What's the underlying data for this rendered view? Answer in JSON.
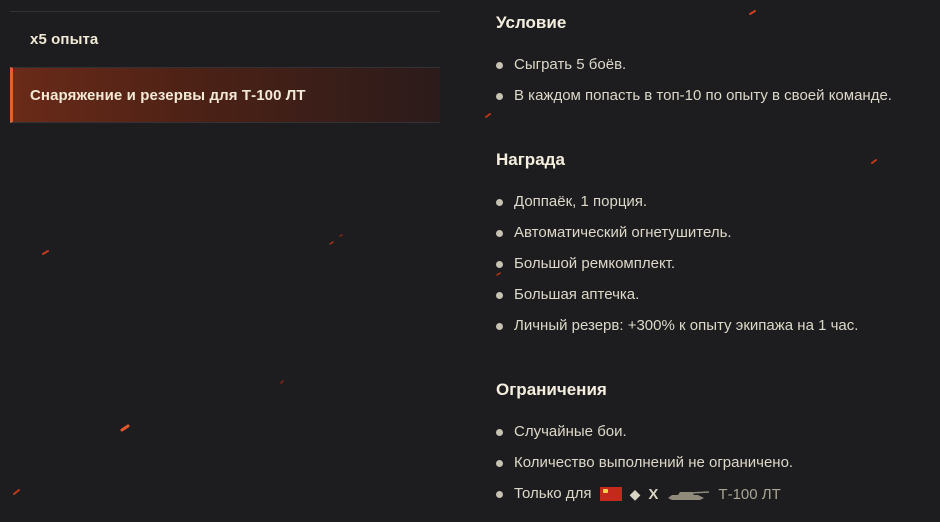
{
  "left_menu": {
    "items": [
      {
        "label": "x5 опыта",
        "active": false
      },
      {
        "label": "Снаряжение и резервы для Т-100 ЛТ",
        "active": true
      }
    ]
  },
  "condition": {
    "title": "Условие",
    "items": [
      "Сыграть 5 боёв.",
      "В каждом попасть в топ-10 по опыту в своей команде."
    ]
  },
  "reward": {
    "title": "Награда",
    "items": [
      "Доппаёк, 1 порция.",
      "Автоматический огнетушитель.",
      "Большой ремкомплект.",
      "Большая аптечка.",
      "Личный резерв: +300% к опыту экипажа на 1 час."
    ]
  },
  "restrictions": {
    "title": "Ограничения",
    "items": [
      "Случайные бои.",
      "Количество выполнений не ограничено."
    ],
    "vehicle_item": {
      "prefix": "Только для",
      "nation_icon": "ussr-flag-icon",
      "type_icon": "light-tank-icon",
      "tier": "X",
      "vehicle_icon": "tank-silhouette-icon",
      "vehicle": "Т-100 ЛТ"
    }
  },
  "colors": {
    "background": "#1d1d1f",
    "accent": "#e2602f",
    "active_item": "#4b2116",
    "title_text": "#f4eedf",
    "body_text": "#ddd8c9"
  }
}
